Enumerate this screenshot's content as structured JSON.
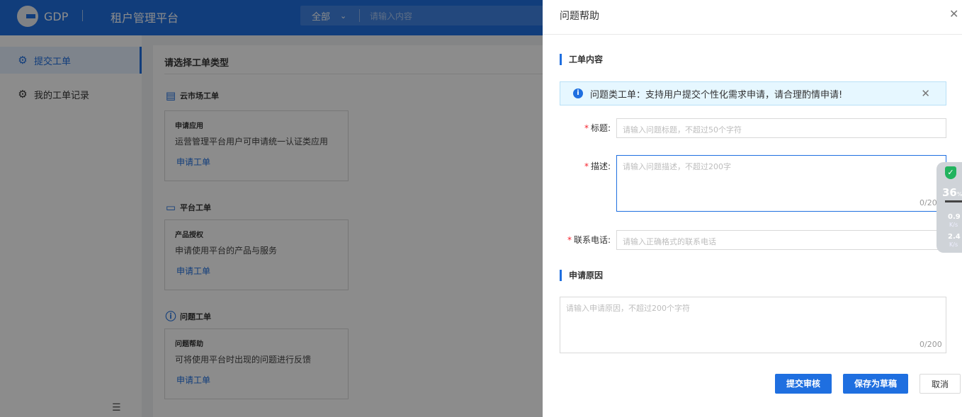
{
  "header": {
    "logo_text": "GDP",
    "app_title": "租户管理平台",
    "search_scope": "全部",
    "search_placeholder": "请输入内容"
  },
  "sidebar": {
    "items": [
      {
        "label": "提交工单",
        "active": true
      },
      {
        "label": "我的工单记录",
        "active": false
      }
    ]
  },
  "main": {
    "title": "请选择工单类型",
    "sections": [
      {
        "heading": "云市场工单",
        "icon": "cloud-market-icon",
        "card_title": "申请应用",
        "card_desc": "运营管理平台用户可申请统一认证类应用",
        "link": "申请工单"
      },
      {
        "heading": "平台工单",
        "icon": "laptop-icon",
        "card_title": "产品授权",
        "card_desc": "申请使用平台的产品与服务",
        "link": "申请工单"
      },
      {
        "heading": "问题工单",
        "icon": "question-icon",
        "card_title": "问题帮助",
        "card_desc": "可将使用平台时出现的问题进行反馈",
        "link": "申请工单"
      }
    ]
  },
  "drawer": {
    "title": "问题帮助",
    "section1": "工单内容",
    "alert": "问题类工单：支持用户提交个性化需求申请，请合理酌情申请!",
    "fields": {
      "title": {
        "label": "标题:",
        "placeholder": "请输入问题标题，不超过50个字符"
      },
      "desc": {
        "label": "描述:",
        "placeholder": "请输入问题描述，不超过200字",
        "counter": "0/200"
      },
      "phone": {
        "label": "联系电话:",
        "placeholder": "请输入正确格式的联系电话"
      }
    },
    "section2": "申请原因",
    "reason": {
      "placeholder": "请输入申请原因，不超过200个字符",
      "counter": "0/200"
    },
    "buttons": {
      "submit": "提交审核",
      "draft": "保存为草稿",
      "cancel": "取消"
    }
  },
  "widget": {
    "percent": "36",
    "percent_unit": "%",
    "up": "0.9",
    "up_unit": "K/s",
    "down": "2.4",
    "down_unit": "K/s"
  },
  "colors": {
    "primary": "#1f6fe0",
    "required": "#f5222d",
    "alert_bg": "#e6f7ff"
  }
}
